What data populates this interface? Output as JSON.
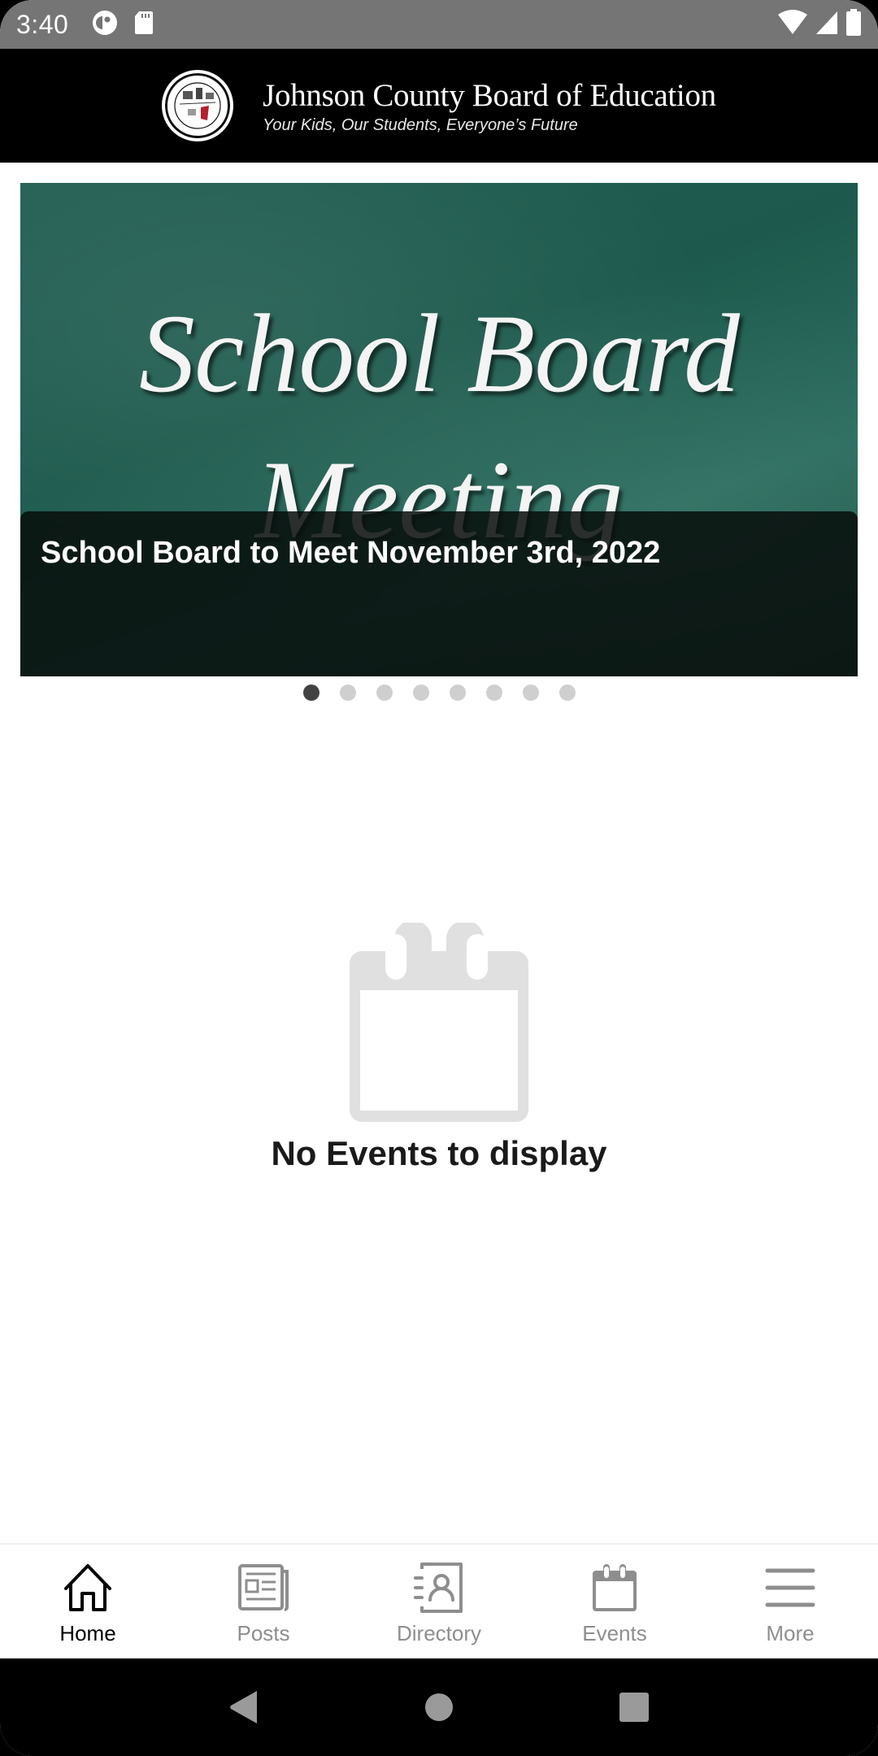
{
  "status_bar": {
    "time": "3:40",
    "left_icons": [
      "sync-icon",
      "sd-card-icon"
    ],
    "right_icons": [
      "wifi-icon",
      "signal-icon",
      "battery-icon"
    ]
  },
  "header": {
    "title": "Johnson County Board of Education",
    "tagline": "Your Kids, Our Students, Everyone’s Future",
    "logo_alt": "Johnson County, Tennessee 1836 - Pride in Diversity seal"
  },
  "carousel": {
    "slide_image_text_line1": "School Board",
    "slide_image_text_line2": "Meeting",
    "caption": "School Board to Meet November 3rd, 2022",
    "total_slides": 8,
    "active_index": 0
  },
  "events": {
    "empty_message": "No Events to display"
  },
  "bottom_nav": {
    "items": [
      {
        "label": "Home",
        "icon": "home-icon",
        "active": true
      },
      {
        "label": "Posts",
        "icon": "newspaper-icon",
        "active": false
      },
      {
        "label": "Directory",
        "icon": "contacts-book-icon",
        "active": false
      },
      {
        "label": "Events",
        "icon": "calendar-icon",
        "active": false
      },
      {
        "label": "More",
        "icon": "menu-icon",
        "active": false
      }
    ]
  },
  "colors": {
    "status_bar": "#757575",
    "header_bg": "#000000",
    "nav_active": "#000000",
    "nav_inactive": "#8e8e8e",
    "dot_active": "#424242",
    "dot_inactive": "#cfcfcf",
    "empty_icon": "#e0e0e0"
  }
}
